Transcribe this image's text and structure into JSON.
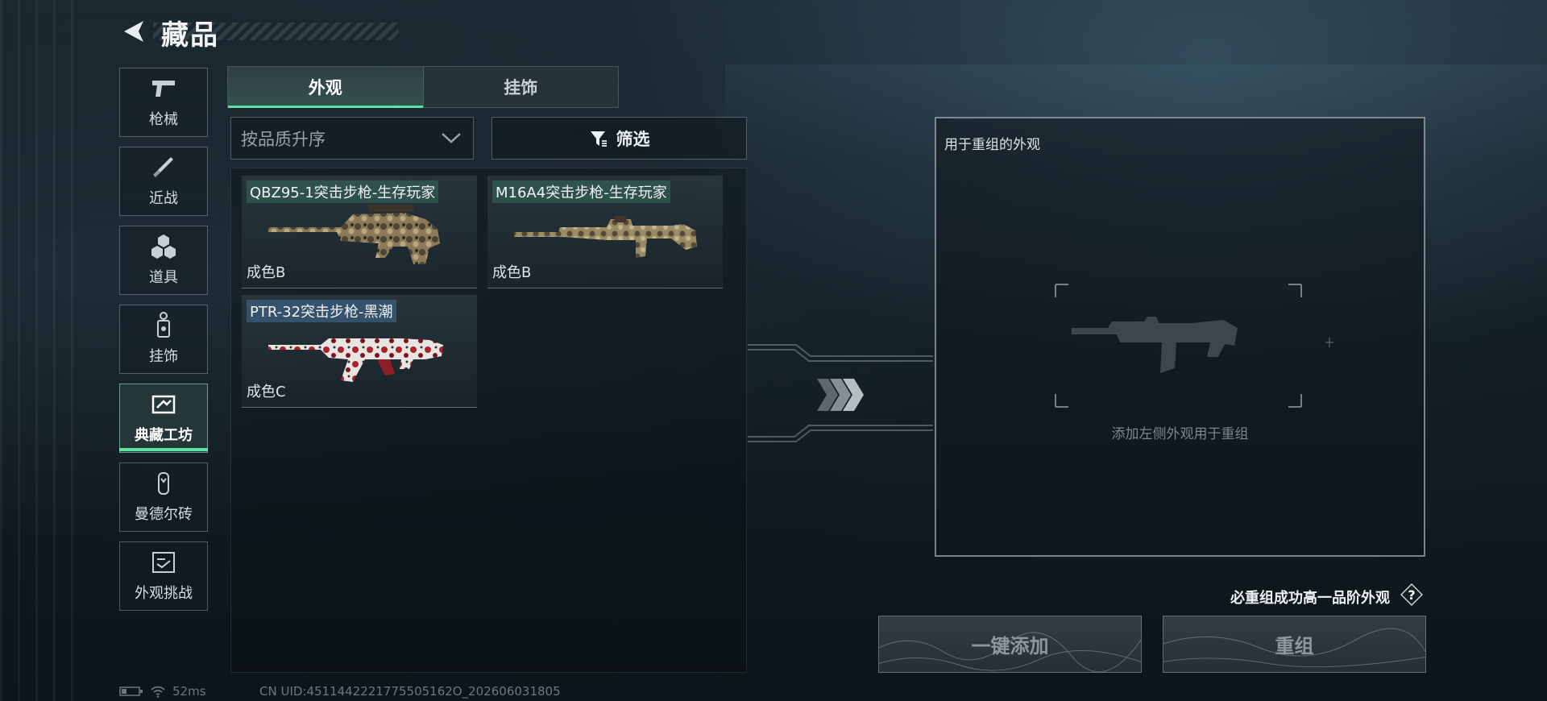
{
  "header": {
    "title": "藏品"
  },
  "sidebar": {
    "items": [
      {
        "label": "枪械",
        "icon": "pistol-icon"
      },
      {
        "label": "近战",
        "icon": "knife-icon"
      },
      {
        "label": "道具",
        "icon": "grenade-icon"
      },
      {
        "label": "挂饰",
        "icon": "charm-icon"
      },
      {
        "label": "典藏工坊",
        "icon": "workshop-icon",
        "active": true
      },
      {
        "label": "曼德尔砖",
        "icon": "brick-icon"
      },
      {
        "label": "外观挑战",
        "icon": "challenge-icon"
      }
    ]
  },
  "tabs": [
    {
      "label": "外观",
      "active": true
    },
    {
      "label": "挂饰",
      "active": false
    }
  ],
  "sort": {
    "value": "按品质升序"
  },
  "filter": {
    "label": "筛选"
  },
  "items": [
    {
      "name": "QBZ95-1突击步枪-生存玩家",
      "grade": "成色B",
      "skin": "camo"
    },
    {
      "name": "M16A4突击步枪-生存玩家",
      "grade": "成色B",
      "skin": "camo"
    },
    {
      "name": "PTR-32突击步枪-黑潮",
      "grade": "成色C",
      "skin": "red-white"
    }
  ],
  "recombine": {
    "title": "用于重组的外观",
    "hint": "添加左侧外观用于重组"
  },
  "note": "必重组成功高一品阶外观",
  "buttons": {
    "add_all": "一键添加",
    "recombine": "重组"
  },
  "status": {
    "ping": "52ms",
    "uid": "CN UID:4511442221775505162O_202606031805"
  },
  "colors": {
    "accent": "#5fe0a5",
    "background": "#121c22"
  }
}
